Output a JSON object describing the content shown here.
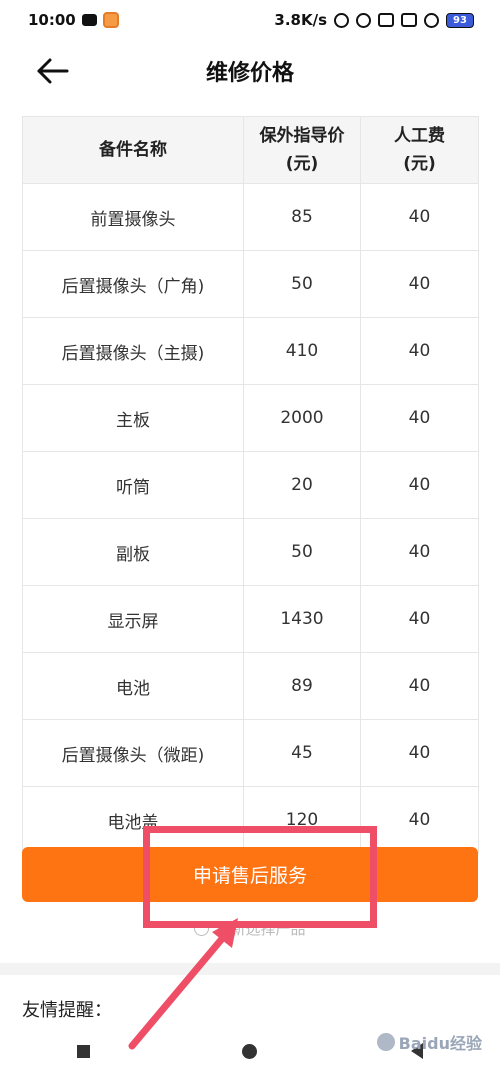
{
  "status_bar": {
    "time": "10:00",
    "net_speed": "3.8K/s",
    "battery": "93"
  },
  "header": {
    "title": "维修价格"
  },
  "table": {
    "headers": [
      [
        "备件名称"
      ],
      [
        "保外指导价",
        "(元)"
      ],
      [
        "人工费",
        "(元)"
      ]
    ],
    "rows": [
      {
        "name": "前置摄像头",
        "price": "85",
        "labor": "40"
      },
      {
        "name": "后置摄像头（广角)",
        "price": "50",
        "labor": "40"
      },
      {
        "name": "后置摄像头（主摄)",
        "price": "410",
        "labor": "40"
      },
      {
        "name": "主板",
        "price": "2000",
        "labor": "40"
      },
      {
        "name": "听筒",
        "price": "20",
        "labor": "40"
      },
      {
        "name": "副板",
        "price": "50",
        "labor": "40"
      },
      {
        "name": "显示屏",
        "price": "1430",
        "labor": "40"
      },
      {
        "name": "电池",
        "price": "89",
        "labor": "40"
      },
      {
        "name": "后置摄像头（微距)",
        "price": "45",
        "labor": "40"
      },
      {
        "name": "电池盖",
        "price": "120",
        "labor": "40"
      }
    ]
  },
  "apply_button": "申请售后服务",
  "switch_link": "重新选择产品",
  "reminder_title": "友情提醒：",
  "watermark": "Baidu经验",
  "colors": {
    "accent": "#ff7412",
    "highlight": "#ee4f66"
  }
}
